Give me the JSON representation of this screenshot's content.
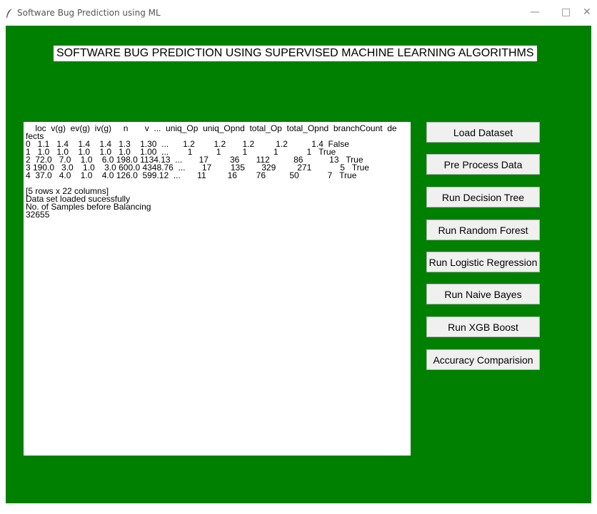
{
  "window": {
    "title": "Software Bug Prediction using ML",
    "minimize": "—",
    "maximize": "□",
    "close": "✕"
  },
  "heading": "SOFTWARE BUG PREDICTION USING SUPERVISED MACHINE LEARNING ALGORITHMS",
  "output": {
    "lines": [
      "    loc  v(g)  ev(g)  iv(g)     n       v  ...  uniq_Op  uniq_Opnd  total_Op  total_Opnd  branchCount  de",
      "fects",
      "0   1.1   1.4    1.4    1.4   1.3    1.30  ...      1.2        1.2       1.2         1.2          1.4  False",
      "1   1.0   1.0    1.0    1.0   1.0    1.00  ...        1          1         1           1            1   True",
      "2  72.0   7.0    1.0    6.0 198.0 1134.13  ...       17         36       112          86           13   True",
      "3 190.0   3.0    1.0    3.0 600.0 4348.76  ...       17        135       329         271            5   True",
      "4  37.0   4.0    1.0    4.0 126.0  599.12  ...       11         16        76          50            7   True",
      "",
      "[5 rows x 22 columns]",
      "Data set loaded sucessfully",
      "No. of Samples before Balancing",
      "32655"
    ]
  },
  "buttons": {
    "load_dataset": "Load Dataset",
    "pre_process": "Pre Process Data",
    "decision_tree": "Run Decision Tree",
    "random_forest": "Run Random Forest",
    "logistic_regression": "Run Logistic Regression",
    "naive_bayes": "Run Naive Bayes",
    "xgb_boost": "Run XGB Boost",
    "accuracy": "Accuracy Comparision"
  },
  "colors": {
    "background": "#008000",
    "panel": "#ffffff",
    "button": "#f0f0f0"
  }
}
